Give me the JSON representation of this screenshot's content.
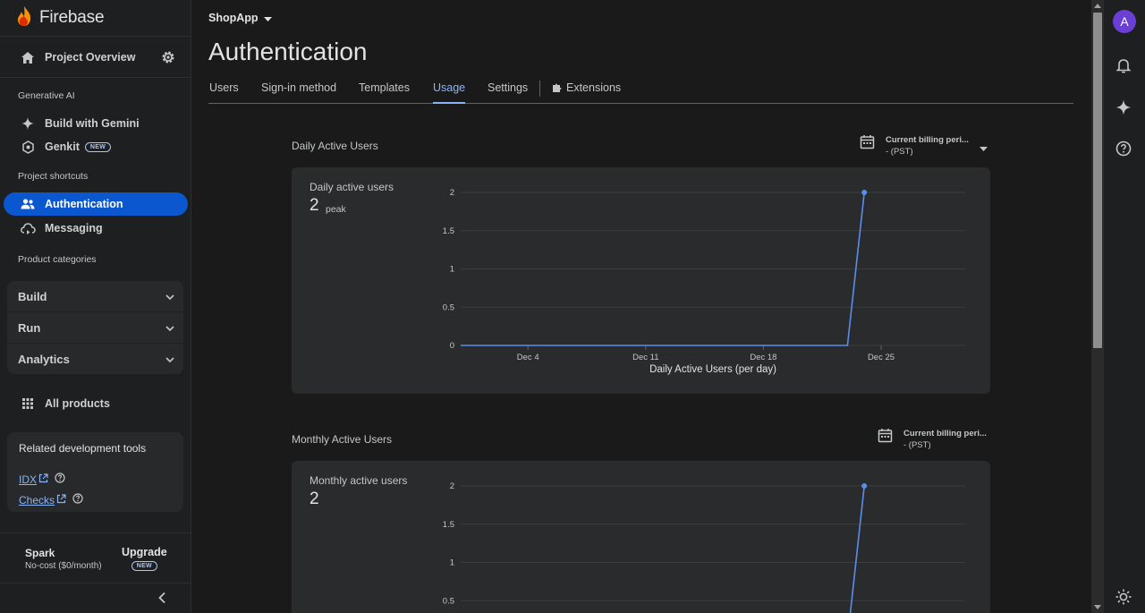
{
  "brand": {
    "name": "Firebase"
  },
  "sidebar": {
    "project_overview": "Project Overview",
    "sections": {
      "generative_ai": "Generative AI",
      "project_shortcuts": "Project shortcuts",
      "product_categories": "Product categories"
    },
    "items": [
      {
        "label": "Build with Gemini",
        "icon": "sparkle-icon"
      },
      {
        "label": "Genkit",
        "icon": "genkit-icon",
        "badge": "NEW"
      },
      {
        "label": "Authentication",
        "icon": "people-icon",
        "active": true
      },
      {
        "label": "Messaging",
        "icon": "cloud-message-icon"
      }
    ],
    "categories": [
      "Build",
      "Run",
      "Analytics"
    ],
    "all_products": "All products",
    "tools": {
      "title": "Related development tools",
      "links": [
        "IDX",
        "Checks"
      ]
    },
    "plan": {
      "name": "Spark",
      "cost": "No-cost ($0/month)",
      "upgrade": "Upgrade",
      "upgrade_badge": "NEW"
    }
  },
  "header": {
    "project": "ShopApp",
    "title": "Authentication",
    "tabs": [
      "Users",
      "Sign-in method",
      "Templates",
      "Usage",
      "Settings",
      "Extensions"
    ],
    "active_tab": "Usage"
  },
  "daily": {
    "section_title": "Daily Active Users",
    "billing": {
      "line1": "Current billing peri...",
      "line2": "- (PST)"
    },
    "metric_label": "Daily active users",
    "metric_value": "2",
    "metric_unit": "peak"
  },
  "monthly": {
    "section_title": "Monthly Active Users",
    "billing": {
      "line1": "Current billing peri...",
      "line2": "- (PST)"
    },
    "metric_label": "Monthly active users",
    "metric_value": "2"
  },
  "chart_data": [
    {
      "type": "line",
      "xlabel": "Daily Active Users (per day)",
      "ylabel": "",
      "x_ticks": [
        "Dec 4",
        "Dec 11",
        "Dec 18",
        "Dec 25"
      ],
      "y_ticks": [
        "0",
        "0.5",
        "1",
        "1.5",
        "2"
      ],
      "ylim": [
        0,
        2
      ],
      "grid": true,
      "series": [
        {
          "color": "#5b8def",
          "points": [
            [
              "Nov 30",
              0
            ],
            [
              "Dec 23",
              0
            ],
            [
              "Dec 24",
              2
            ]
          ]
        }
      ]
    },
    {
      "type": "line",
      "xlabel": "",
      "ylabel": "",
      "y_ticks": [
        "0.5",
        "1",
        "1.5",
        "2"
      ],
      "ylim": [
        0,
        2
      ],
      "grid": true,
      "series": [
        {
          "color": "#5b8def",
          "points": [
            [
              "Dec 23",
              0
            ],
            [
              "Dec 24",
              2
            ]
          ]
        }
      ]
    }
  ],
  "rail": {
    "avatar_letter": "A"
  },
  "colors": {
    "accent": "#0b57d0",
    "link": "#8ab4f8",
    "series": "#5b8def",
    "avatar": "#6b3fd6"
  }
}
